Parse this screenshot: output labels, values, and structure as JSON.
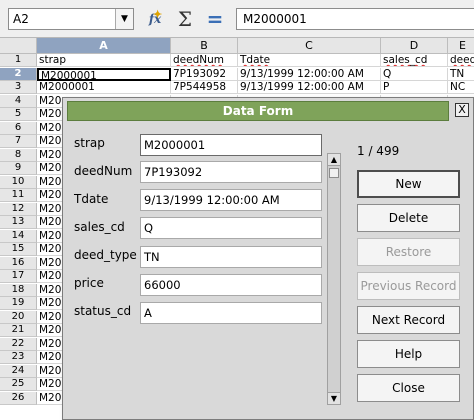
{
  "formula_bar": {
    "name_box": "A2",
    "name_box_dropdown_icon": "chevron-down-icon",
    "function_wizard_icon": "fx-icon",
    "function_wizard_label": "fx",
    "sum_icon": "sigma-icon",
    "sum_label": "Σ",
    "formula_icon": "equals-icon",
    "formula_label": "=",
    "input": "M2000001"
  },
  "sheet": {
    "columns": [
      "A",
      "B",
      "C",
      "D",
      "E"
    ],
    "header_row": [
      "strap",
      "deedNum",
      "Tdate",
      "sales_cd",
      "deed"
    ],
    "rows": [
      [
        "M2000001",
        "7P193092",
        "9/13/1999 12:00:00 AM",
        "Q",
        "TN"
      ],
      [
        "M2000001",
        "7P544958",
        "9/13/1999 12:00:00 AM",
        "P",
        "NC"
      ],
      [
        "M20",
        "",
        "",
        "",
        ""
      ],
      [
        "M20",
        "",
        "",
        "",
        ""
      ],
      [
        "M20",
        "",
        "",
        "",
        ""
      ],
      [
        "M20",
        "",
        "",
        "",
        ""
      ],
      [
        "M20",
        "",
        "",
        "",
        ""
      ],
      [
        "M20",
        "",
        "",
        "",
        ""
      ],
      [
        "M20",
        "",
        "",
        "",
        ""
      ],
      [
        "M20",
        "",
        "",
        "",
        ""
      ],
      [
        "M20",
        "",
        "",
        "",
        ""
      ],
      [
        "M20",
        "",
        "",
        "",
        ""
      ],
      [
        "M20",
        "",
        "",
        "",
        ""
      ],
      [
        "M20",
        "",
        "",
        "",
        ""
      ],
      [
        "M20",
        "",
        "",
        "",
        ""
      ],
      [
        "M20",
        "",
        "",
        "",
        ""
      ],
      [
        "M20",
        "",
        "",
        "",
        ""
      ],
      [
        "M20",
        "",
        "",
        "",
        ""
      ],
      [
        "M20",
        "",
        "",
        "",
        ""
      ],
      [
        "M20",
        "",
        "",
        "",
        ""
      ],
      [
        "M20",
        "",
        "",
        "",
        ""
      ],
      [
        "M20",
        "",
        "",
        "",
        ""
      ],
      [
        "M20",
        "",
        "",
        "",
        ""
      ],
      [
        "M20",
        "",
        "",
        "",
        ""
      ],
      [
        "M20",
        "",
        "",
        "",
        ""
      ]
    ],
    "row_numbers": [
      "1",
      "2",
      "3",
      "4",
      "5",
      "6",
      "7",
      "8",
      "9",
      "10",
      "11",
      "12",
      "13",
      "14",
      "15",
      "16",
      "17",
      "18",
      "19",
      "20",
      "21",
      "22",
      "23",
      "24",
      "25",
      "26"
    ]
  },
  "dialog": {
    "title": "Data Form",
    "close_label": "X",
    "record_counter": "1 / 499",
    "fields": [
      {
        "label": "strap",
        "value": "M2000001"
      },
      {
        "label": "deedNum",
        "value": "7P193092"
      },
      {
        "label": "Tdate",
        "value": "9/13/1999 12:00:00 AM"
      },
      {
        "label": "sales_cd",
        "value": "Q"
      },
      {
        "label": "deed_type",
        "value": "TN"
      },
      {
        "label": "price",
        "value": "66000"
      },
      {
        "label": "status_cd",
        "value": "A"
      }
    ],
    "buttons": {
      "new": "New",
      "delete": "Delete",
      "restore": "Restore",
      "previous": "Previous Record",
      "next": "Next Record",
      "help": "Help",
      "close": "Close"
    },
    "scroll_up_glyph": "▲",
    "scroll_down_glyph": "▼"
  }
}
